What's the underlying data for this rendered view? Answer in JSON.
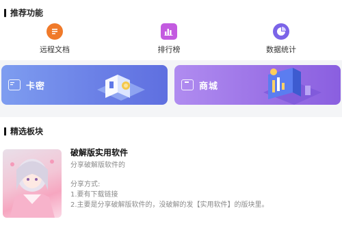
{
  "recommended": {
    "title": "推荐功能",
    "features": [
      {
        "label": "远程文档",
        "icon": "document-icon",
        "color": "#f07a2a"
      },
      {
        "label": "排行榜",
        "icon": "bar-chart-icon",
        "color": "#c35be0"
      },
      {
        "label": "数据统计",
        "icon": "pie-chart-icon",
        "color": "#7b64e8"
      }
    ]
  },
  "banners": [
    {
      "label": "卡密",
      "icon": "card-icon",
      "color": "#6a84e6"
    },
    {
      "label": "商城",
      "icon": "shop-icon",
      "color": "#9b72e6"
    }
  ],
  "featured": {
    "title": "精选板块",
    "item": {
      "title": "破解版实用软件",
      "subtitle": "分享破解版软件的",
      "desc_lines": [
        "分享方式:",
        "1.要有下载链接",
        "2.主要是分享破解版软件的，没破解的发【实用软件】的版块里。"
      ]
    }
  }
}
